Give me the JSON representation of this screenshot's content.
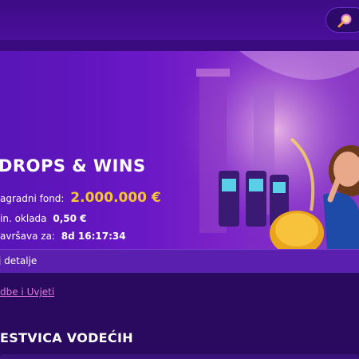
{
  "header": {
    "search_icon": "search-icon"
  },
  "promo": {
    "title": "DROPS & WINS",
    "prize_pool_label": "agradni fond:",
    "prize_pool_value": "2.000.000 €",
    "min_bet_label": "in. oklada",
    "min_bet_value": "0,50 €",
    "ends_label": "avršava za:",
    "ends_value": "8d 16:17:34"
  },
  "details": {
    "label": "j detalje"
  },
  "terms": {
    "label": "dbe i Uvjeti"
  },
  "leaderboard": {
    "title": "ESTVICA VODEĆIH"
  },
  "colors": {
    "accent": "#f7c23c",
    "link": "#e07ad8",
    "background": "#2a0a5e"
  }
}
